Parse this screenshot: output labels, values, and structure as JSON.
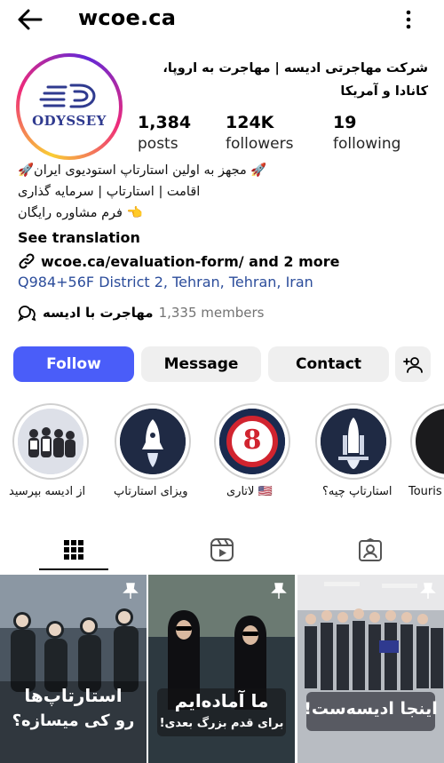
{
  "header": {
    "username": "wcoe.ca"
  },
  "profile": {
    "full_name": "شرکت مهاجرتی ادیسه | مهاجرت به اروپا، کانادا و آمریکا",
    "logo_text": "ODYSSEY",
    "stats": [
      {
        "value": "1,384",
        "label": "posts"
      },
      {
        "value": "124K",
        "label": "followers"
      },
      {
        "value": "19",
        "label": "following"
      }
    ],
    "bio": [
      "🚀 مجهز به اولین استارتاپ استودیوی ایران🚀",
      "اقامت | استارتاپ | سرمایه گذاری",
      "👈 فرم مشاوره رایگان"
    ],
    "see_translation": "See translation",
    "link": "wcoe.ca/evaluation-form/ and 2 more",
    "address": "Q984+56F District 2, Tehran, Tehran, Iran",
    "channel": {
      "name": "مهاجرت  با ادیسه",
      "members": "1,335 members"
    }
  },
  "actions": {
    "follow": "Follow",
    "message": "Message",
    "contact": "Contact"
  },
  "highlights": [
    {
      "label": "از ادیسه بپرسید"
    },
    {
      "label": "ویزای استارتاپ"
    },
    {
      "label": "لاتاری 🇺🇸",
      "badge": "8"
    },
    {
      "label": "استارتاپ چیه؟"
    },
    {
      "label": "Touris"
    }
  ],
  "tabs": [
    {
      "icon": "grid-icon"
    },
    {
      "icon": "reels-icon"
    },
    {
      "icon": "tagged-icon"
    }
  ],
  "posts": [
    {
      "caption_line1": "استارتاپ‌ها",
      "caption_line2": "رو کی میسازه؟"
    },
    {
      "caption_line1": "ما آماده‌ایم",
      "caption_line2": "برای قدم بزرگ بعدی!"
    },
    {
      "caption_line1": "اینجا ادیسه‌ست!",
      "caption_line2": ""
    }
  ],
  "colors": {
    "follow": "#4a5df9",
    "address": "#2c4d9b",
    "logo": "#2f3a8f"
  }
}
